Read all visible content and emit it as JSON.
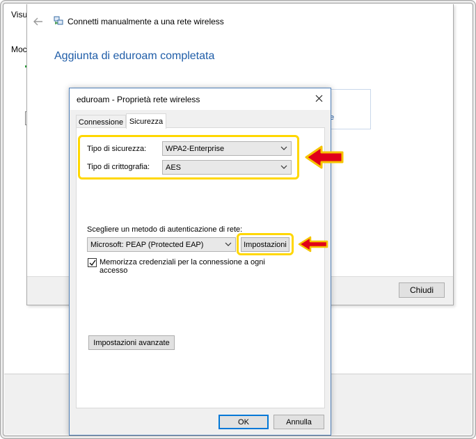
{
  "background": {
    "side_text_1": "Visu",
    "side_text_2": "Moc"
  },
  "wizard": {
    "title": "Connetti manualmente a una rete wireless",
    "heading": "Aggiunta di eduroam completata",
    "partial_link": "e",
    "close_button": "Chiudi"
  },
  "dialog": {
    "title": "eduroam - Proprietà rete wireless",
    "tabs": [
      "Connessione",
      "Sicurezza"
    ],
    "active_tab": "Sicurezza",
    "security_type_label": "Tipo di sicurezza:",
    "security_type_value": "WPA2-Enterprise",
    "encryption_type_label": "Tipo di crittografia:",
    "encryption_type_value": "AES",
    "auth_method_label": "Scegliere un metodo di autenticazione di rete:",
    "auth_method_value": "Microsoft: PEAP (Protected EAP)",
    "settings_button": "Impostazioni",
    "remember_checkbox_label": "Memorizza credenziali per la connessione a ogni accesso",
    "remember_checked": true,
    "advanced_button": "Impostazioni avanzate",
    "ok_button": "OK",
    "cancel_button": "Annulla"
  },
  "colors": {
    "highlight": "#ffd700",
    "arrow_fill": "#e0001a",
    "arrow_stroke": "#f5c400",
    "heading": "#1f5da8"
  }
}
